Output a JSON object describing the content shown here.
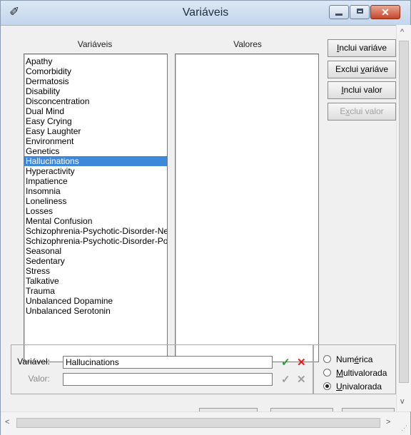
{
  "window": {
    "title": "Variáveis",
    "close_glyph": "✕",
    "app_icon": "pencil-eraser-icon"
  },
  "headers": {
    "variables": "Variáveis",
    "values": "Valores"
  },
  "variables": [
    "Apathy",
    "Comorbidity",
    "Dermatosis",
    "Disability",
    "Disconcentration",
    "Dual Mind",
    "Easy Crying",
    "Easy Laughter",
    "Environment",
    "Genetics",
    "Hallucinations",
    "Hyperactivity",
    "Impatience",
    "Insomnia",
    "Loneliness",
    "Losses",
    "Mental Confusion",
    "Schizophrenia-Psychotic-Disorder-Neg",
    "Schizophrenia-Psychotic-Disorder-Pos",
    "Seasonal",
    "Sedentary",
    "Stress",
    "Talkative",
    "Trauma",
    "Unbalanced Dopamine",
    "Unbalanced Serotonin"
  ],
  "selected_index": 10,
  "buttons": {
    "add_variable": {
      "pre": "",
      "u": "I",
      "post": "nclui variáve"
    },
    "remove_variable": {
      "pre": "Exclui ",
      "u": "v",
      "post": "ariáve"
    },
    "add_value": {
      "pre": "",
      "u": "I",
      "post": "nclui valor"
    },
    "remove_value": {
      "pre": "E",
      "u": "x",
      "post": "clui valor"
    }
  },
  "form": {
    "variable_label": "Variável:",
    "variable_value": "Hallucinations",
    "value_label": "Valor:",
    "value_value": "",
    "confirm_glyph": "✓",
    "cancel_glyph": "✕"
  },
  "types": {
    "numeric": {
      "pre": "Num",
      "u": "é",
      "post": "rica"
    },
    "multivalued": {
      "pre": "",
      "u": "M",
      "post": "ultivalorada"
    },
    "univalued": {
      "pre": "",
      "u": "U",
      "post": "nivalorada"
    },
    "selected": "univalued"
  },
  "colors": {
    "selection": "#3f87d9",
    "confirm_active": "#1f9a2e",
    "cancel_active": "#e02020",
    "disabled": "#a0a0a0"
  }
}
